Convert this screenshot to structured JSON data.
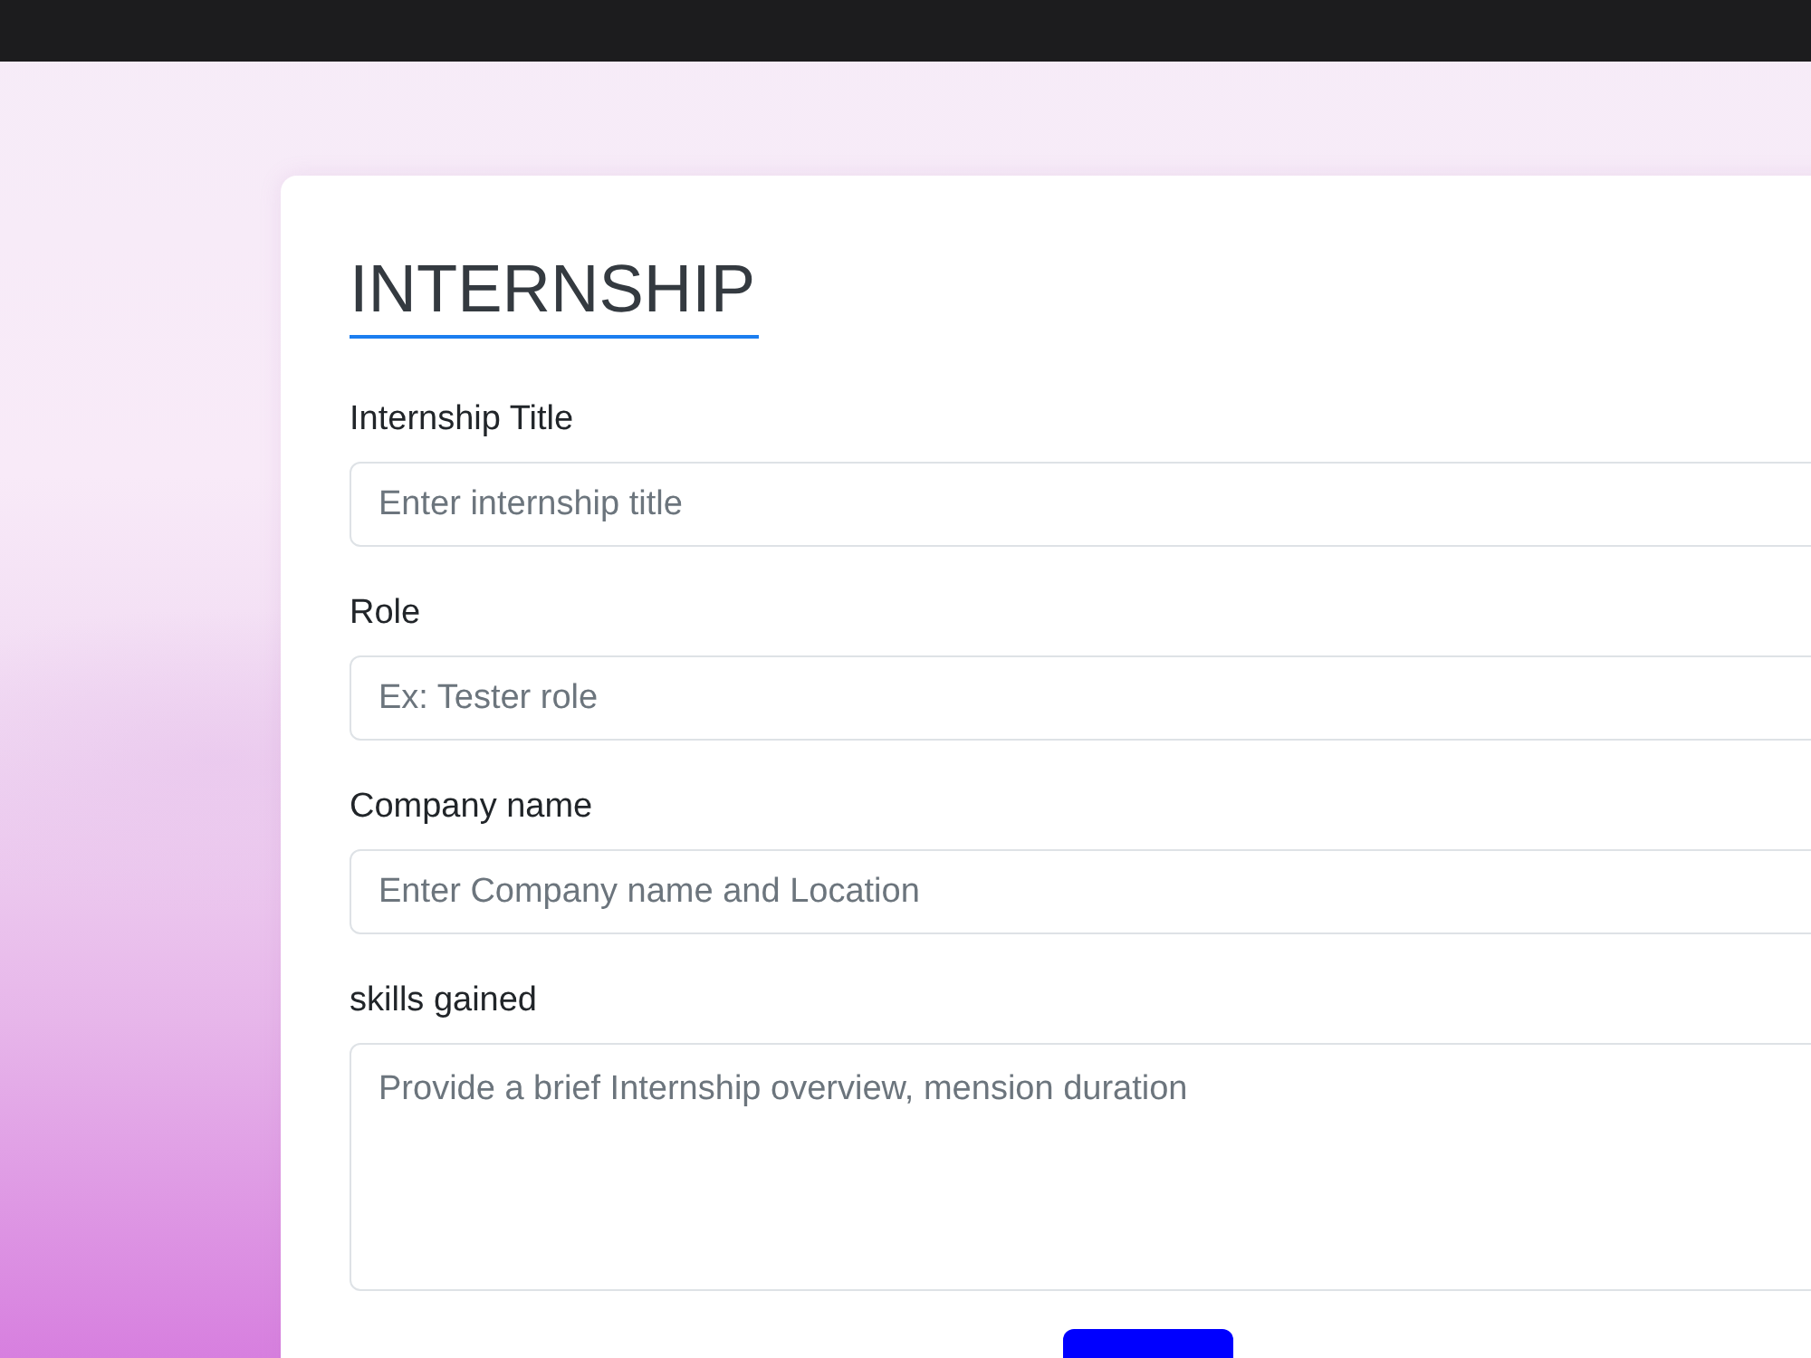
{
  "form": {
    "title": "INTERNSHIP",
    "fields": [
      {
        "kind": "input",
        "label": "Internship Title",
        "placeholder": "Enter internship title"
      },
      {
        "kind": "input",
        "label": "Role",
        "placeholder": "Ex: Tester role"
      },
      {
        "kind": "input",
        "label": "Company name",
        "placeholder": "Enter Company name and Location"
      },
      {
        "kind": "textarea",
        "label": "skills gained",
        "placeholder": "Provide a brief Internship overview, mension duration"
      }
    ],
    "buttons": [
      {
        "kind": "primary"
      }
    ]
  }
}
